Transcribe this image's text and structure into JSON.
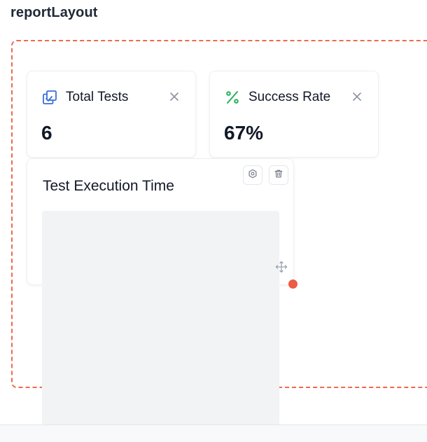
{
  "page": {
    "title": "reportLayout"
  },
  "colors": {
    "dashed_border": "#ee6a4f",
    "resize_dot": "#ee5a43",
    "total_icon": "#3b6fd8",
    "success_icon": "#22b35e",
    "placeholder": "#f2f3f5"
  },
  "widgets": {
    "total_tests": {
      "label": "Total Tests",
      "value": "6",
      "icon": "copy-check-icon"
    },
    "success_rate": {
      "label": "Success Rate",
      "value": "67%",
      "icon": "percent-icon"
    },
    "test_execution_time": {
      "title": "Test Execution Time"
    }
  }
}
